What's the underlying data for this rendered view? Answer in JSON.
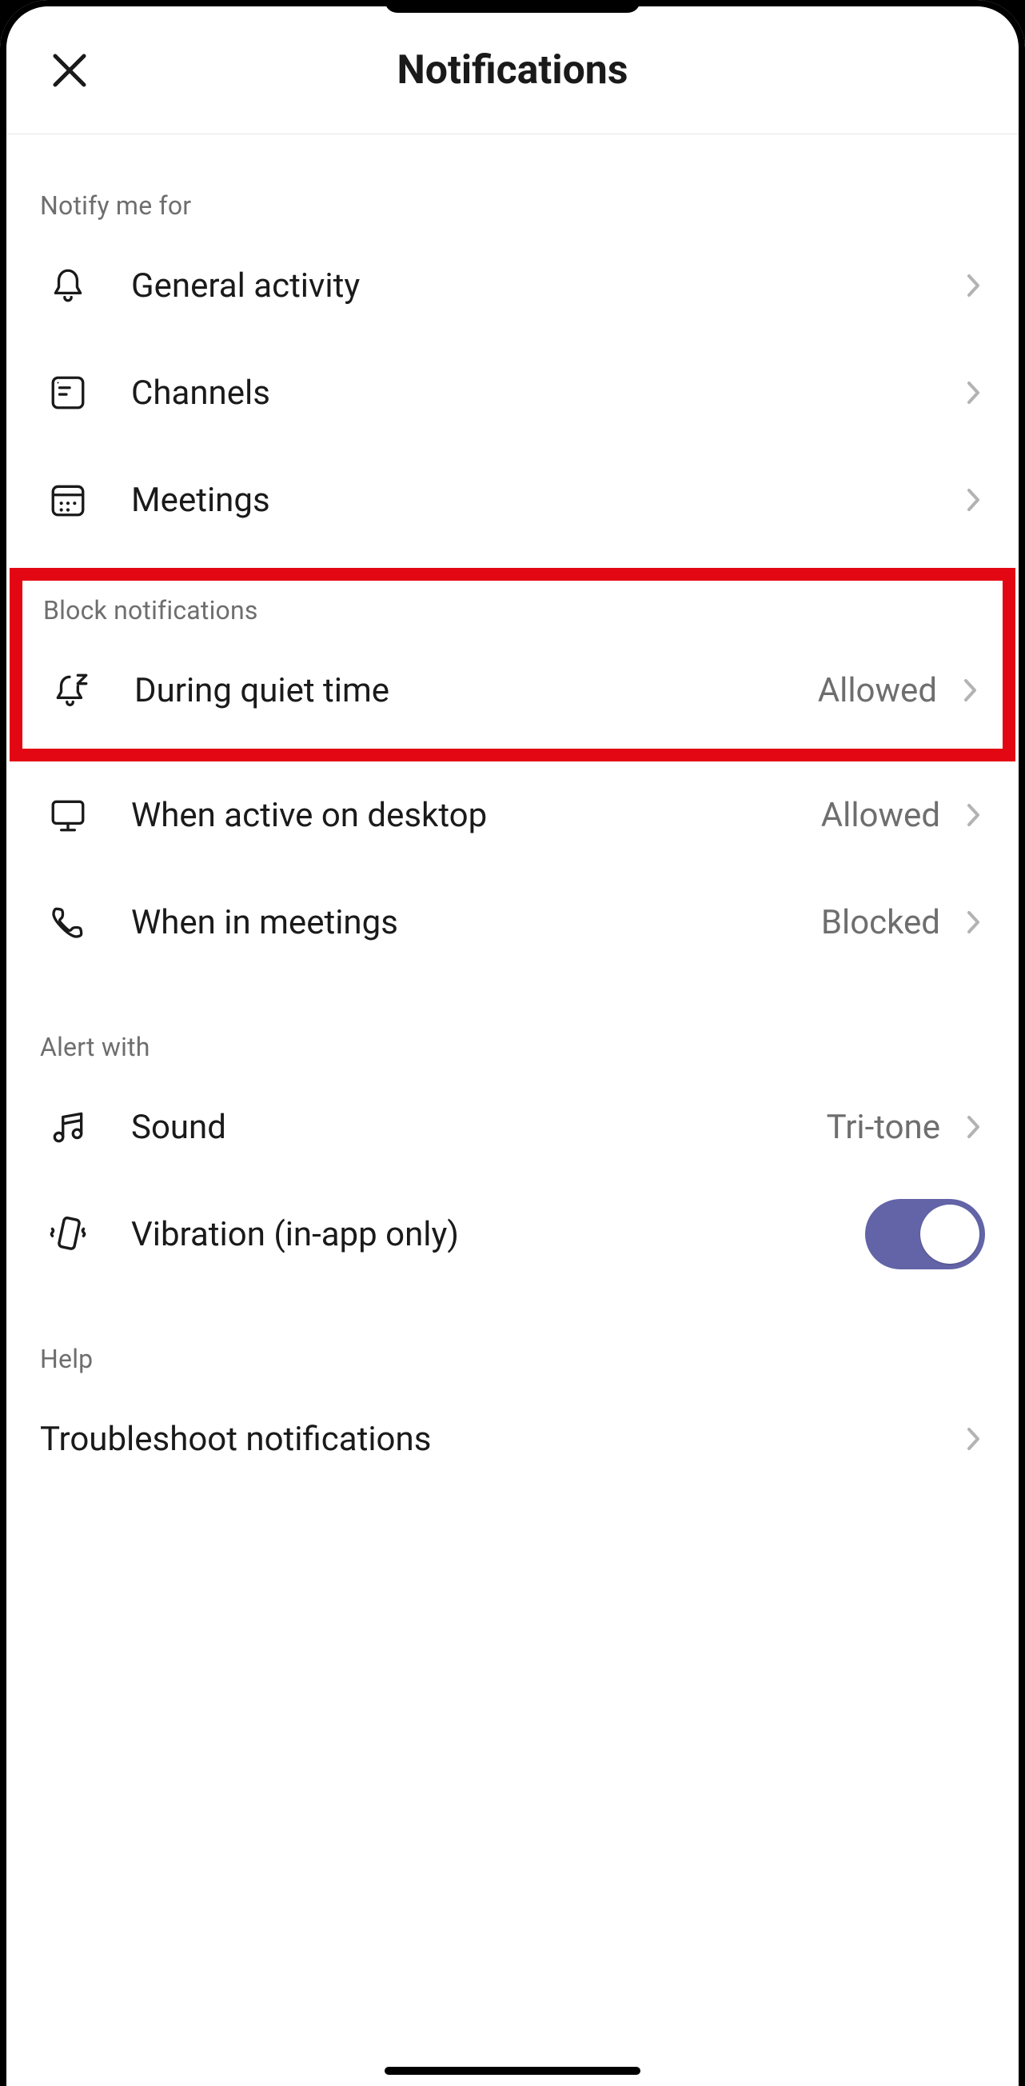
{
  "header": {
    "title": "Notifications"
  },
  "sections": {
    "notify": {
      "header": "Notify me for",
      "general_activity": "General activity",
      "channels": "Channels",
      "meetings": "Meetings"
    },
    "block": {
      "header": "Block notifications",
      "quiet_time": {
        "label": "During quiet time",
        "value": "Allowed"
      },
      "desktop": {
        "label": "When active on desktop",
        "value": "Allowed"
      },
      "meetings": {
        "label": "When in meetings",
        "value": "Blocked"
      }
    },
    "alert": {
      "header": "Alert with",
      "sound": {
        "label": "Sound",
        "value": "Tri-tone"
      },
      "vibration": {
        "label": "Vibration (in-app only)",
        "on": true
      }
    },
    "help": {
      "header": "Help",
      "troubleshoot": "Troubleshoot notifications"
    }
  },
  "colors": {
    "highlight_border": "#e30613",
    "toggle_on": "#6264a7"
  }
}
